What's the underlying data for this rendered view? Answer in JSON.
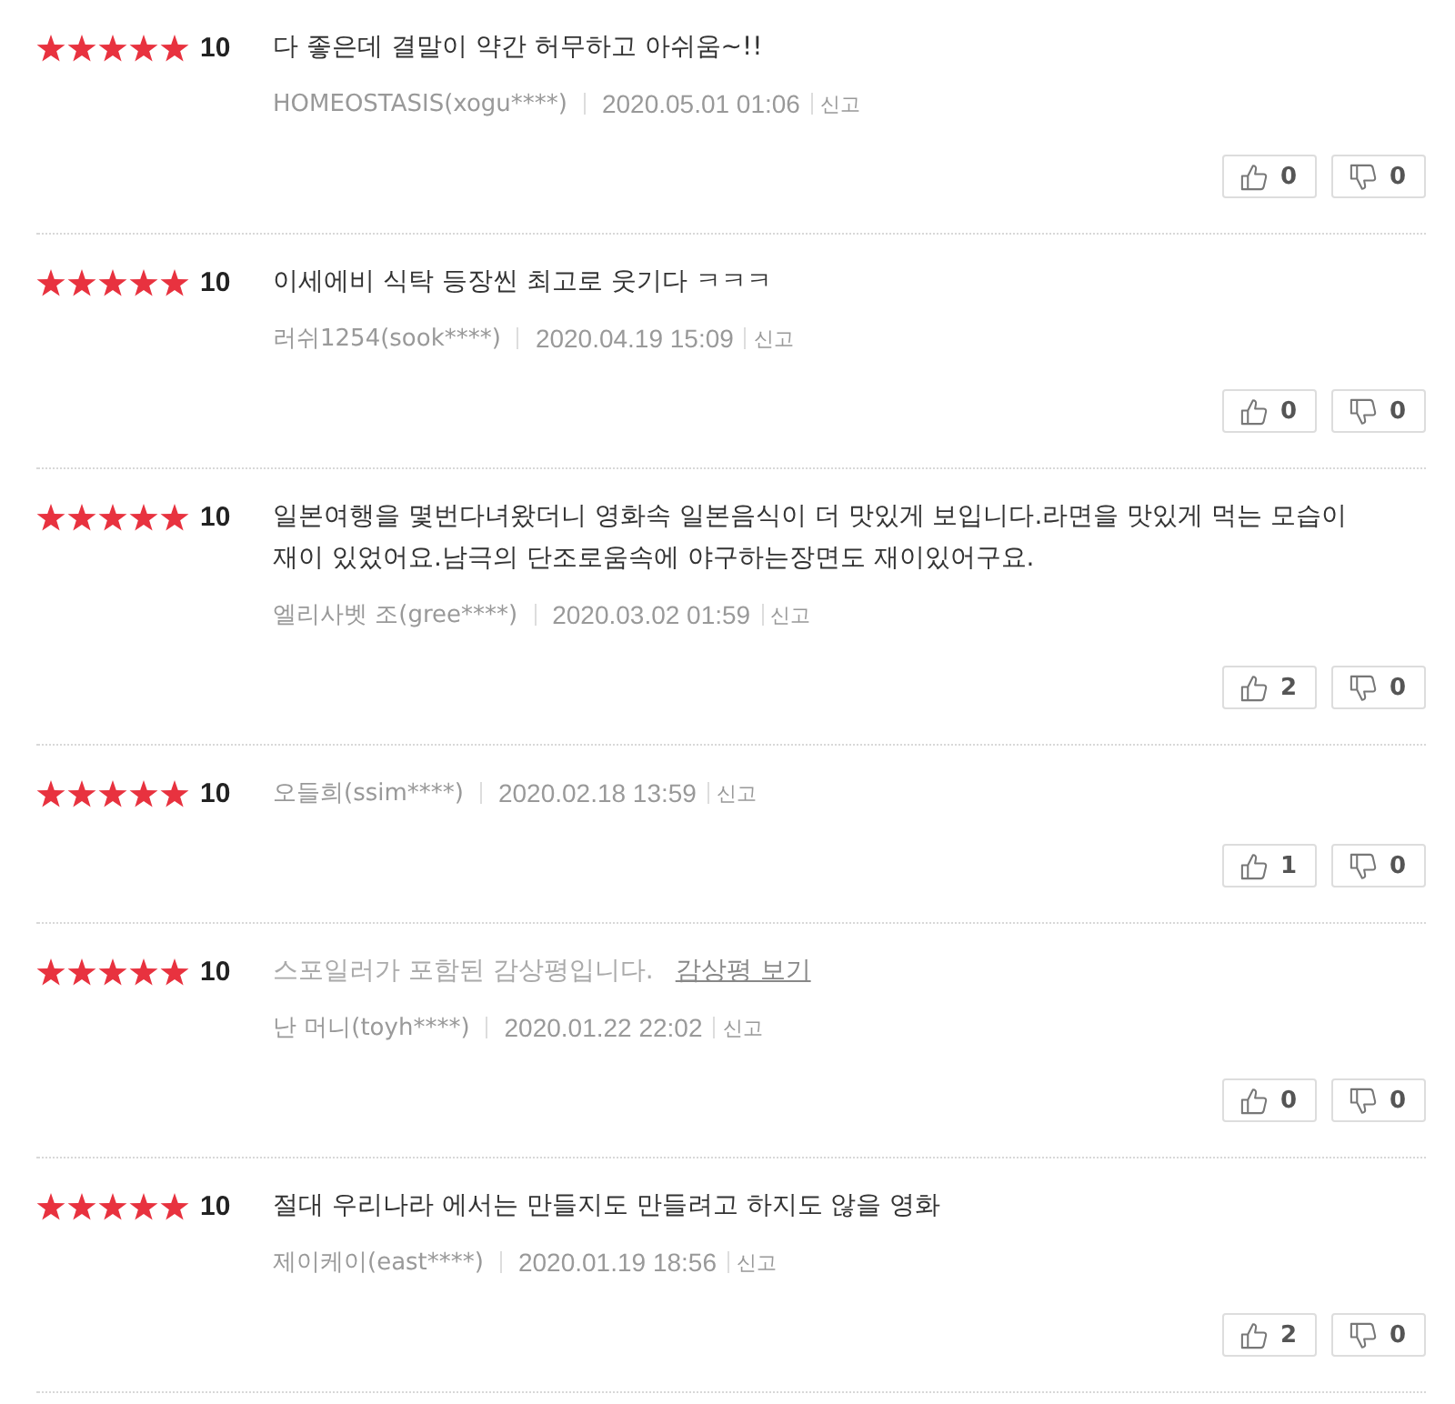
{
  "reviews": [
    {
      "stars": 5,
      "score": "10",
      "comment": "다 좋은데 결말이 약간 허무하고 아쉬움~!!",
      "author": "HOMEOSTASIS(xogu****)",
      "date": "2020.05.01 01:06",
      "report": "신고",
      "likes": "0",
      "dislikes": "0"
    },
    {
      "stars": 5,
      "score": "10",
      "comment": "이세에비 식탁 등장씬 최고로 웃기다 ㅋㅋㅋ",
      "author": "러쉬1254(sook****)",
      "date": "2020.04.19 15:09",
      "report": "신고",
      "likes": "0",
      "dislikes": "0"
    },
    {
      "stars": 5,
      "score": "10",
      "comment": "일본여행을 몇번다녀왔더니 영화속 일본음식이 더 맛있게 보입니다.라면을 맛있게 먹는 모습이 재이 있었어요.남극의 단조로움속에 야구하는장면도 재이있어구요.",
      "author": "엘리사벳 조(gree****)",
      "date": "2020.03.02 01:59",
      "report": "신고",
      "likes": "2",
      "dislikes": "0"
    },
    {
      "stars": 5,
      "score": "10",
      "author": "오들희(ssim****)",
      "date": "2020.02.18 13:59",
      "report": "신고",
      "likes": "1",
      "dislikes": "0"
    },
    {
      "stars": 5,
      "score": "10",
      "spoiler": {
        "notice": "스포일러가 포함된 감상평입니다.",
        "link": "감상평 보기"
      },
      "author": "난 머니(toyh****)",
      "date": "2020.01.22 22:02",
      "report": "신고",
      "likes": "0",
      "dislikes": "0"
    },
    {
      "stars": 5,
      "score": "10",
      "comment": "절대 우리나라 에서는 만들지도 만들려고 하지도 않을 영화",
      "author": "제이케이(east****)",
      "date": "2020.01.19 18:56",
      "report": "신고",
      "likes": "2",
      "dislikes": "0"
    }
  ]
}
